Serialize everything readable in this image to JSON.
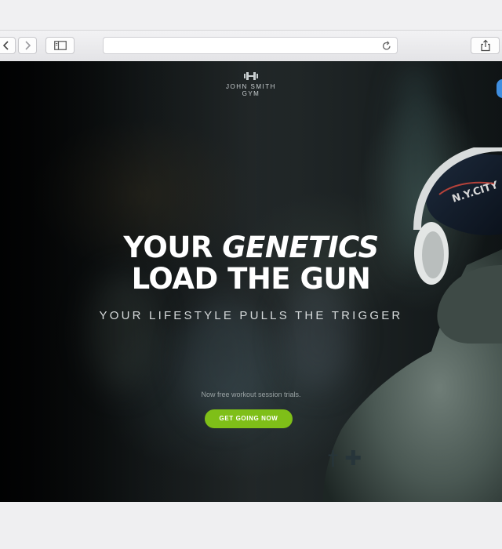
{
  "browser": {
    "back_icon": "chevron-left-icon",
    "forward_icon": "chevron-right-icon",
    "sidebar_icon": "sidebar-icon",
    "reload_icon": "reload-icon",
    "share_icon": "share-icon",
    "url": ""
  },
  "hero": {
    "logo_line1": "JOHN SMITH",
    "logo_line2": "GYM",
    "headline_plain": "YOUR ",
    "headline_emphasis": "GENETICS",
    "headline_line2": "LOAD THE GUN",
    "subheadline": "YOUR LIFESTYLE PULLS THE TRIGGER",
    "note": "Now free workout session trials.",
    "cta_label": "GET GOING NOW",
    "cta_color": "#7fbf18",
    "cap_text": "N.Y.CITY"
  }
}
